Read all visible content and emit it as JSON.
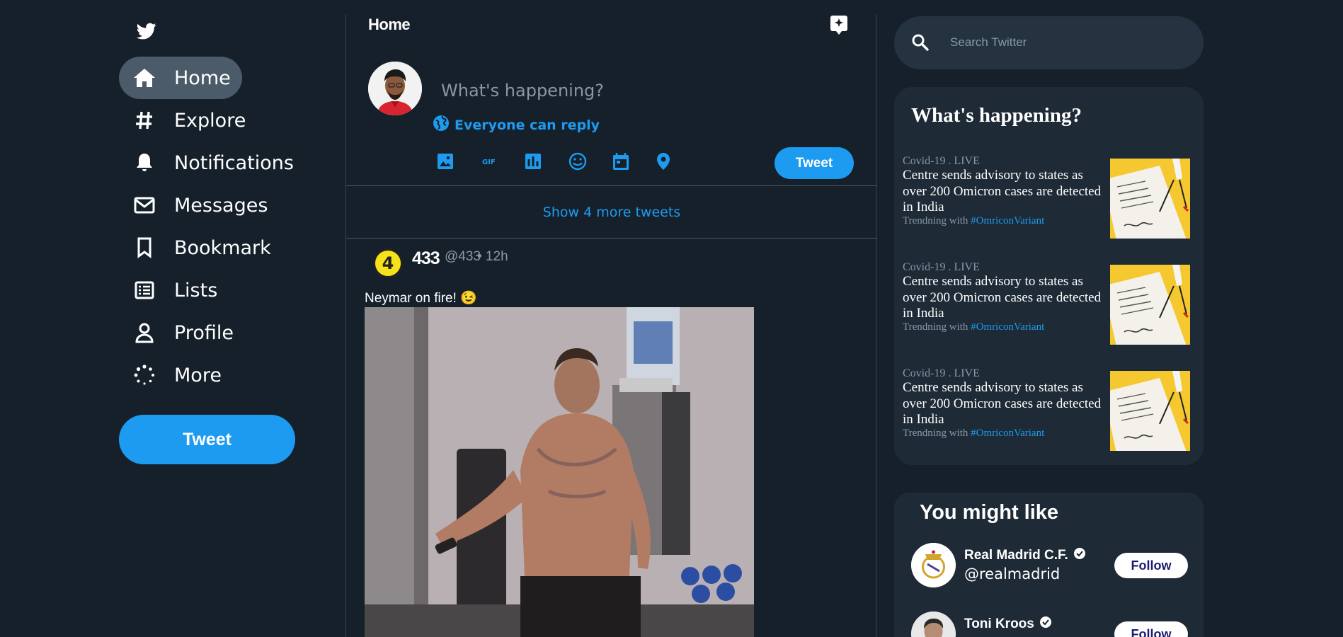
{
  "sidebar": {
    "items": [
      {
        "label": "Home",
        "icon": "home-icon",
        "active": true
      },
      {
        "label": "Explore",
        "icon": "hashtag-icon"
      },
      {
        "label": "Notifications",
        "icon": "bell-icon"
      },
      {
        "label": "Messages",
        "icon": "envelope-icon"
      },
      {
        "label": "Bookmark",
        "icon": "bookmark-icon"
      },
      {
        "label": "Lists",
        "icon": "list-icon"
      },
      {
        "label": "Profile",
        "icon": "user-icon"
      },
      {
        "label": "More",
        "icon": "more-dots-icon"
      }
    ],
    "tweet_label": "Tweet"
  },
  "feed": {
    "title": "Home",
    "compose": {
      "placeholder": "What's happening?",
      "reply_label": "Everyone can reply",
      "tweet_label": "Tweet",
      "tools": [
        "image-icon",
        "gif-icon",
        "poll-icon",
        "emoji-icon",
        "schedule-icon",
        "location-icon"
      ]
    },
    "show_more": "Show 4 more tweets",
    "tweet": {
      "avatar_text": "4",
      "name": "433",
      "handle": "@433",
      "time": "• 12h",
      "text": "Neymar on fire! 😉"
    }
  },
  "right": {
    "search_placeholder": "Search Twitter",
    "happening_title": "What's happening?",
    "trends": [
      {
        "meta": "Covid-19 . LIVE",
        "headline": "Centre sends advisory to states as over 200 Omicron cases are detected in India",
        "trending_prefix": "Trendning with",
        "tag": "#OmriconVariant"
      },
      {
        "meta": "Covid-19 . LIVE",
        "headline": "Centre sends advisory to states as over 200 Omicron cases are detected in India",
        "trending_prefix": "Trendning with",
        "tag": "#OmriconVariant"
      },
      {
        "meta": "Covid-19 . LIVE",
        "headline": "Centre sends advisory to states as over 200 Omicron cases are detected in India",
        "trending_prefix": "Trendning with",
        "tag": "#OmriconVariant"
      }
    ],
    "like_title": "You might like",
    "users": [
      {
        "name": "Real Madrid C.F.",
        "handle": "@realmadrid",
        "follow": "Follow"
      },
      {
        "name": "Toni Kroos",
        "handle": "",
        "follow": "Follow"
      }
    ]
  },
  "colors": {
    "background": "#15202b",
    "accent": "#1d9bf0",
    "card": "#1e2a36",
    "muted": "#8899a6"
  }
}
